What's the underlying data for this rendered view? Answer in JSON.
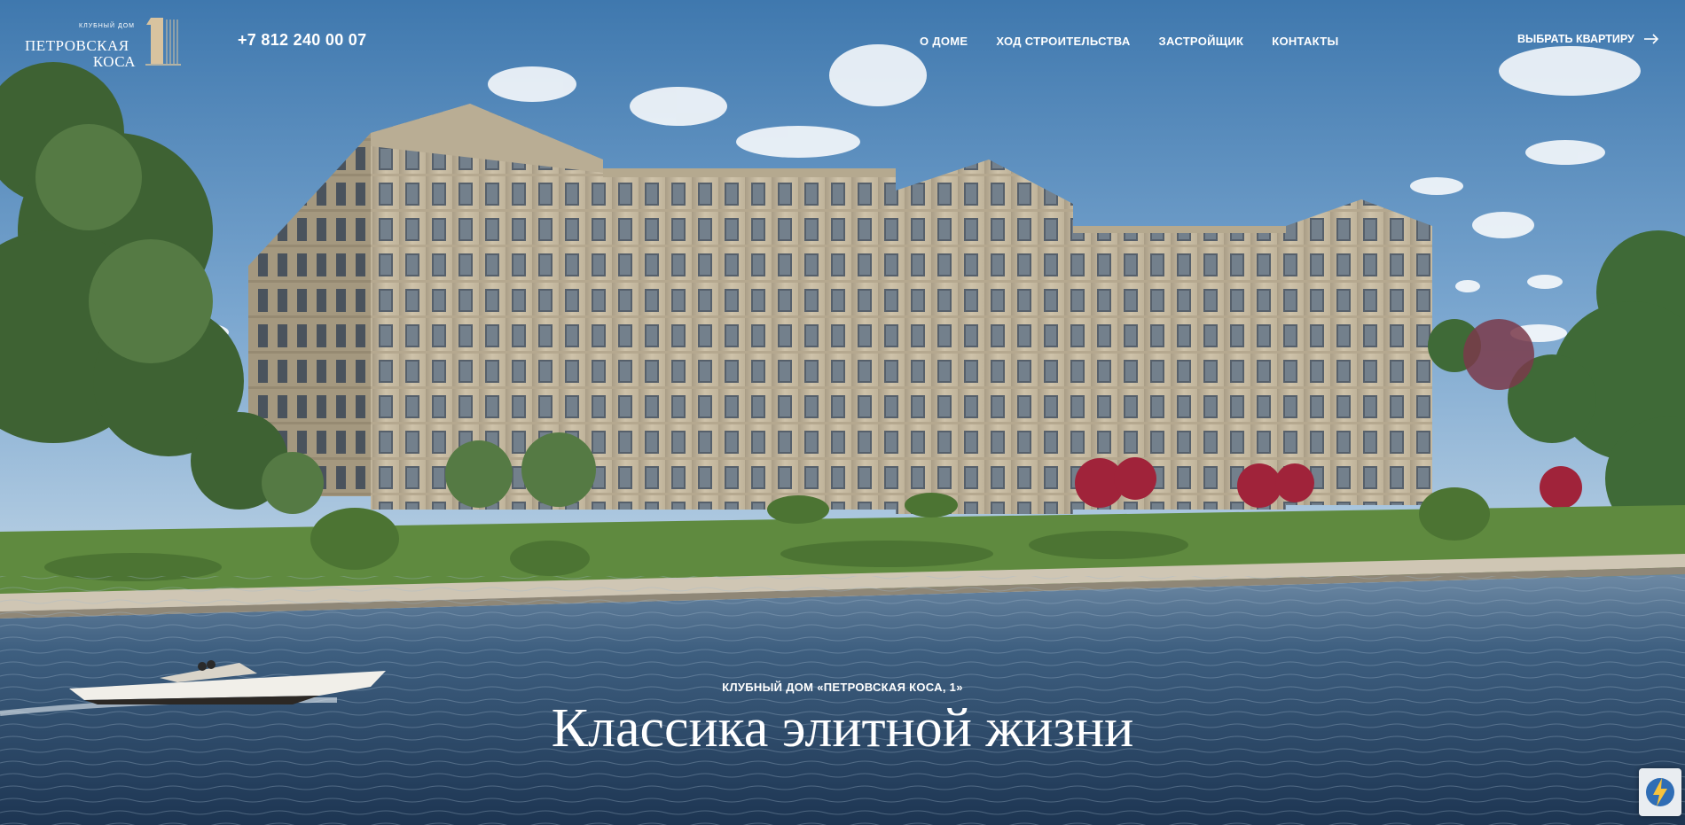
{
  "brand": {
    "small_caption": "КЛУБНЫЙ ДОМ",
    "name_line1": "ПЕТРОВСКАЯ",
    "name_line2": "КОСА",
    "mark_number": "1"
  },
  "header": {
    "phone": "+7 812 240 00 07",
    "nav": [
      "О ДОМЕ",
      "ХОД СТРОИТЕЛЬСТВА",
      "ЗАСТРОЙЩИК",
      "КОНТАКТЫ"
    ],
    "cta_label": "ВЫБРАТЬ КВАРТИРУ",
    "cta_icon": "arrow-right-icon"
  },
  "hero": {
    "kicker": "КЛУБНЫЙ ДОМ «ПЕТРОВСКАЯ КОСА, 1»",
    "title": "Классика элитной жизни"
  },
  "widget": {
    "icon": "lightning-icon"
  },
  "colors": {
    "sky_top": "#3f78ae",
    "sky_bottom": "#a9c6df",
    "facade": "#c9bda4",
    "water": "#2c4a6a",
    "accent_gold": "#c8a77a"
  }
}
